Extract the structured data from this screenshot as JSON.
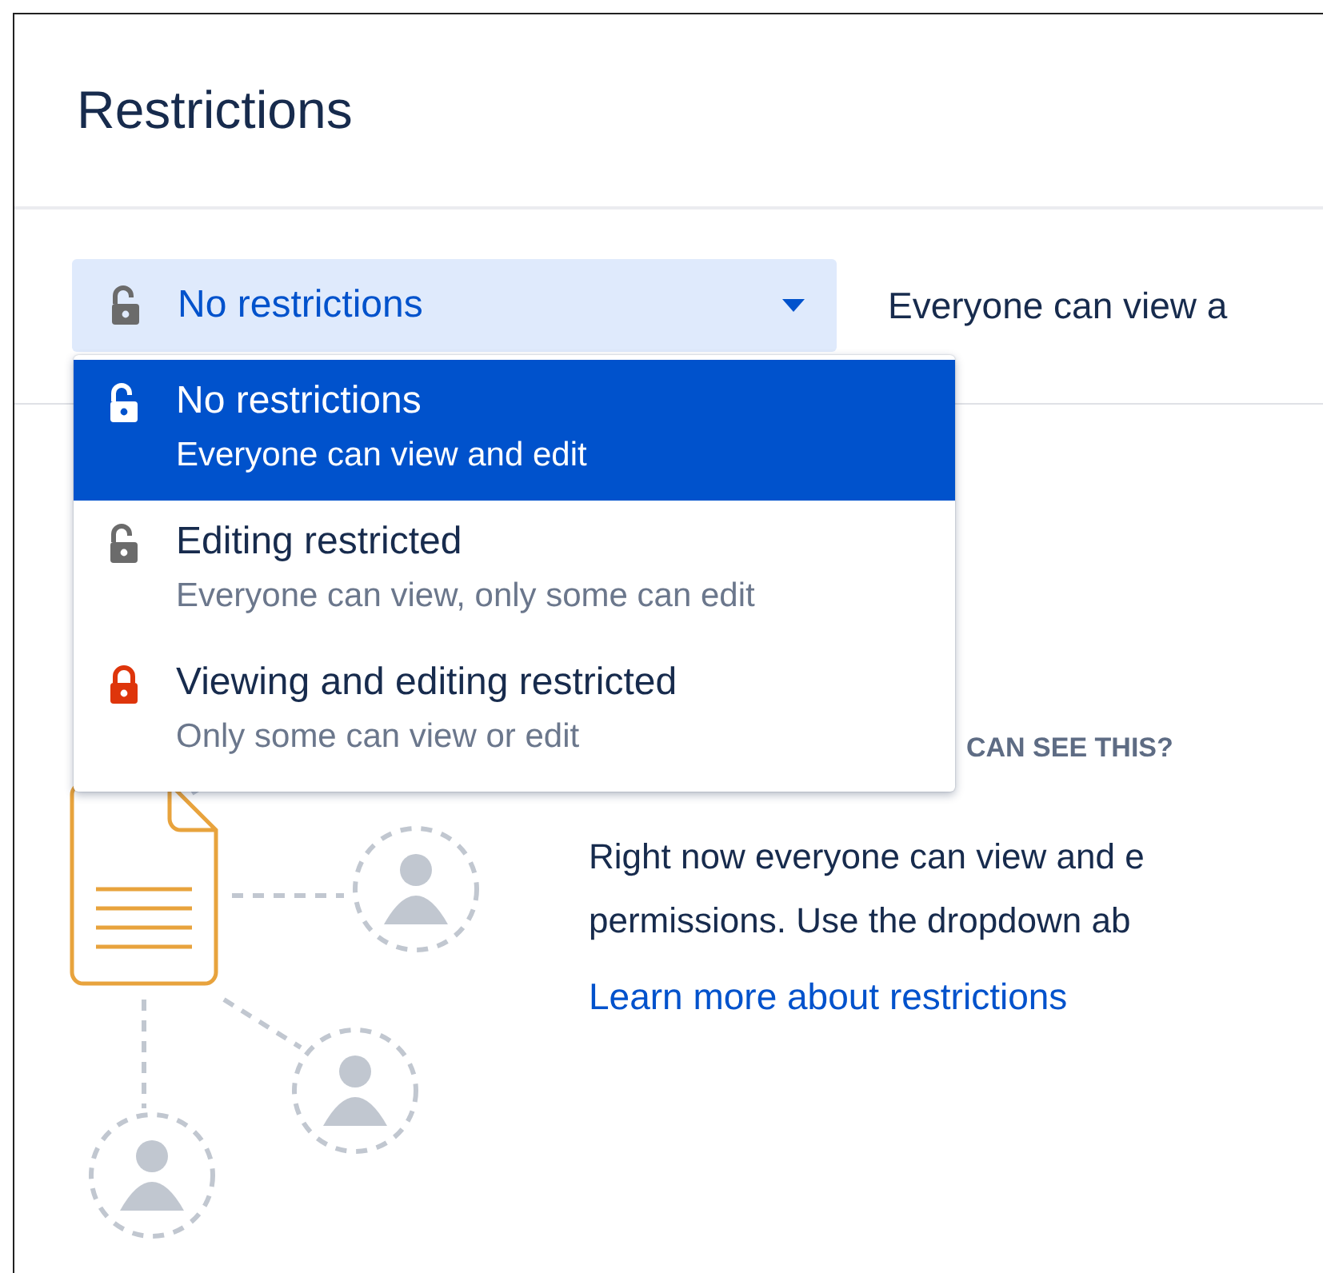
{
  "page": {
    "title": "Restrictions"
  },
  "dropdown": {
    "value": "No restrictions",
    "expanded": true,
    "description": "Everyone can view a"
  },
  "menu": [
    {
      "kind": "unlocked",
      "label": "No restrictions",
      "description": "Everyone can view and edit",
      "selected": true
    },
    {
      "kind": "unlocked",
      "label": "Editing restricted",
      "description": "Everyone can view, only some can edit",
      "selected": false
    },
    {
      "kind": "locked",
      "label": "Viewing and editing restricted",
      "description": "Only some can view or edit",
      "selected": false
    }
  ],
  "info": {
    "heading": "CAN SEE THIS?",
    "body_lines": [
      "Right now everyone can view and e",
      "permissions. Use the dropdown ab"
    ],
    "link": "Learn more about restrictions"
  }
}
